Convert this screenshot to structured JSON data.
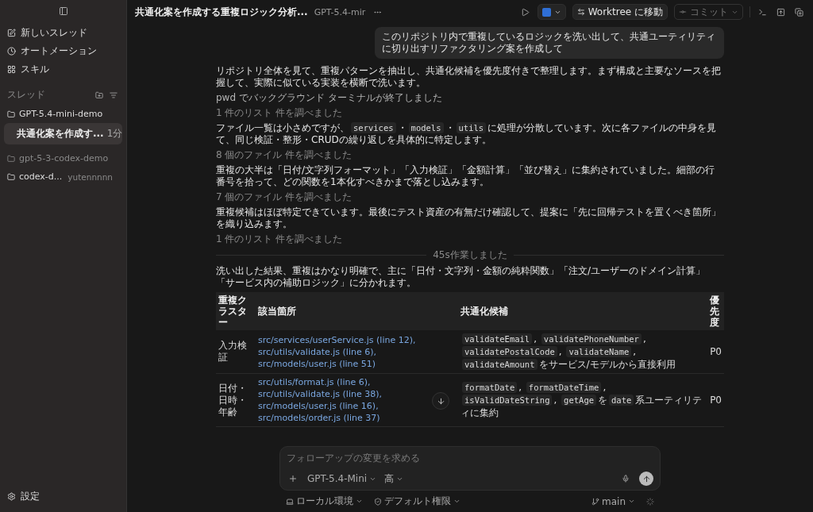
{
  "sidebar": {
    "nav": [
      {
        "kind": "edit",
        "label": "新しいスレッド"
      },
      {
        "kind": "clock",
        "label": "オートメーション"
      },
      {
        "kind": "grid",
        "label": "スキル"
      }
    ],
    "section_title": "スレッド",
    "projects": [
      {
        "name": "GPT-5.4-mini-demo",
        "muted": false,
        "children": [
          {
            "title": "共通化案を作成す...",
            "time": "1分",
            "selected": true
          }
        ]
      },
      {
        "name": "gpt-5-3-codex-demo",
        "muted": true
      },
      {
        "name": "codex-d...",
        "muted": false,
        "meta": "yutennnnn"
      }
    ],
    "settings": "設定"
  },
  "header": {
    "title": "共通化案を作成する重複ロジック分析...",
    "model": "GPT-5.4-mir",
    "worktree_button": "Worktree に移動",
    "commit_button": {
      "label": "コミット",
      "disabled": true
    }
  },
  "user_message": "このリポジトリ内で重複しているロジックを洗い出して、共通ユーティリティに切り出すリファクタリング案を作成して",
  "messages": [
    {
      "kind": "text",
      "parts": [
        {
          "kind": "plain",
          "text": "リポジトリ全体を見て、重複パターンを抽出し、共通化候補を優先度付きで整理します。まず構成と主要なソースを把握して、実際に似ている実装を横断で洗います。"
        }
      ]
    },
    {
      "kind": "log",
      "parts": [
        {
          "kind": "plain",
          "text": "pwd でバックグラウンド ターミナルが終了しました"
        }
      ]
    },
    {
      "kind": "note",
      "parts": [
        {
          "kind": "plain",
          "text": "1 件のリスト 件を調べました"
        }
      ]
    },
    {
      "kind": "text",
      "parts": [
        {
          "kind": "plain",
          "text": "ファイル一覧は小さめですが、"
        },
        {
          "kind": "code",
          "text": "services"
        },
        {
          "kind": "plain",
          "text": "・"
        },
        {
          "kind": "code",
          "text": "models"
        },
        {
          "kind": "plain",
          "text": "・"
        },
        {
          "kind": "code",
          "text": "utils"
        },
        {
          "kind": "plain",
          "text": "に処理が分散しています。次に各ファイルの中身を見て、同じ検証・整形・CRUDの繰り返しを具体的に特定します。"
        }
      ]
    },
    {
      "kind": "note",
      "parts": [
        {
          "kind": "plain",
          "text": "8 個のファイル 件を調べました"
        }
      ]
    },
    {
      "kind": "text",
      "parts": [
        {
          "kind": "plain",
          "text": "重複の大半は「日付/文字列フォーマット」「入力検証」「金額計算」「並び替え」に集約されていました。細部の行番号を拾って、どの関数を1本化すべきかまで落とし込みます。"
        }
      ]
    },
    {
      "kind": "note",
      "parts": [
        {
          "kind": "plain",
          "text": "7 個のファイル 件を調べました"
        }
      ]
    },
    {
      "kind": "text",
      "parts": [
        {
          "kind": "plain",
          "text": "重複候補はほぼ特定できています。最後にテスト資産の有無だけ確認して、提案に「先に回帰テストを置くべき箇所」を織り込みます。"
        }
      ]
    },
    {
      "kind": "note",
      "parts": [
        {
          "kind": "plain",
          "text": "1 件のリスト 件を調べました"
        }
      ]
    },
    {
      "kind": "divider",
      "parts": [
        {
          "kind": "plain",
          "text": "45s作業しました"
        }
      ]
    },
    {
      "kind": "text",
      "parts": [
        {
          "kind": "plain",
          "text": "洗い出した結果、重複はかなり明確で、主に「日付・文字列・金額の純粋関数」「注文/ユーザーのドメイン計算」「サービス内の補助ロジック」に分かれます。"
        }
      ]
    }
  ],
  "table": {
    "columns": [
      "重複クラスター",
      "該当箇所",
      "共通化候補",
      "優先度"
    ],
    "rows": [
      {
        "cluster": "入力検証",
        "locations": [
          "src/services/userService.js (line 12),",
          "src/utils/validate.js (line 6),",
          "src/models/user.js (line 51)"
        ],
        "candidates": [
          {
            "kind": "code",
            "text": "validateEmail"
          },
          {
            "kind": "plain",
            "text": ", "
          },
          {
            "kind": "code",
            "text": "validatePhoneNumber"
          },
          {
            "kind": "plain",
            "text": ", "
          },
          {
            "kind": "code",
            "text": "validatePostalCode"
          },
          {
            "kind": "plain",
            "text": ", "
          },
          {
            "kind": "code",
            "text": "validateName"
          },
          {
            "kind": "plain",
            "text": ", "
          },
          {
            "kind": "code",
            "text": "validateAmount"
          },
          {
            "kind": "plain",
            "text": "をサービス/モデルから直接利用"
          }
        ],
        "priority": "P0"
      },
      {
        "cluster": "日付・日時・年齢",
        "locations": [
          "src/utils/format.js (line 6),",
          "src/utils/validate.js (line 38),",
          "src/models/user.js (line 16),",
          "src/models/order.js (line 37)"
        ],
        "candidates": [
          {
            "kind": "code",
            "text": "formatDate"
          },
          {
            "kind": "plain",
            "text": ", "
          },
          {
            "kind": "code",
            "text": "formatDateTime"
          },
          {
            "kind": "plain",
            "text": ", "
          },
          {
            "kind": "code",
            "text": "isValidDateString"
          },
          {
            "kind": "plain",
            "text": ", "
          },
          {
            "kind": "code",
            "text": "getAge"
          },
          {
            "kind": "plain",
            "text": "を"
          },
          {
            "kind": "code",
            "text": "date"
          },
          {
            "kind": "plain",
            "text": "系ユーティリティに集約"
          }
        ],
        "priority": "P0"
      }
    ]
  },
  "composer": {
    "placeholder": "フォローアップの変更を求める",
    "model": "GPT-5.4-Mini",
    "effort": "高",
    "environment": "ローカル環境",
    "permission": "デフォルト権限",
    "branch": "main"
  }
}
